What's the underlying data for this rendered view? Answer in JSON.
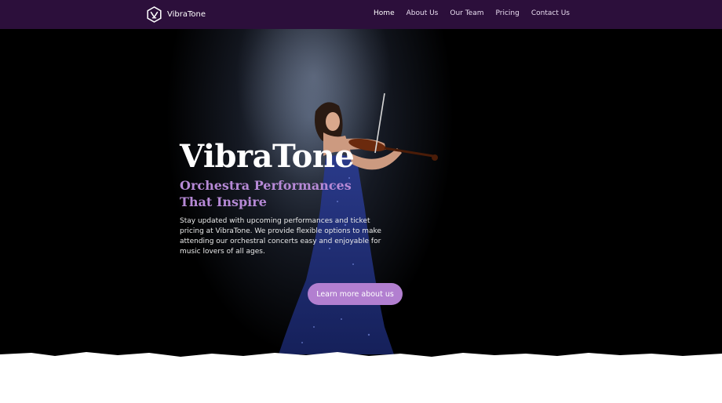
{
  "header": {
    "brand": "VibraTone",
    "nav": [
      {
        "label": "Home",
        "active": true
      },
      {
        "label": "About Us",
        "active": false
      },
      {
        "label": "Our Team",
        "active": false
      },
      {
        "label": "Pricing",
        "active": false
      },
      {
        "label": "Contact Us",
        "active": false
      }
    ]
  },
  "hero": {
    "title": "VibraTone",
    "subtitle": "Orchestra Performances That Inspire",
    "description": "Stay updated with upcoming performances and ticket pricing at VibraTone. We provide flexible options to make attending our orchestral concerts easy and enjoyable for music lovers of all ages.",
    "cta_label": "Learn more about us",
    "image": "violinist-in-blue-gown"
  },
  "colors": {
    "header_bg": "#2c0f3b",
    "accent": "#b27fd0",
    "subtitle": "#b689d6",
    "hero_bg": "#000000",
    "page_bg": "#ffffff"
  }
}
